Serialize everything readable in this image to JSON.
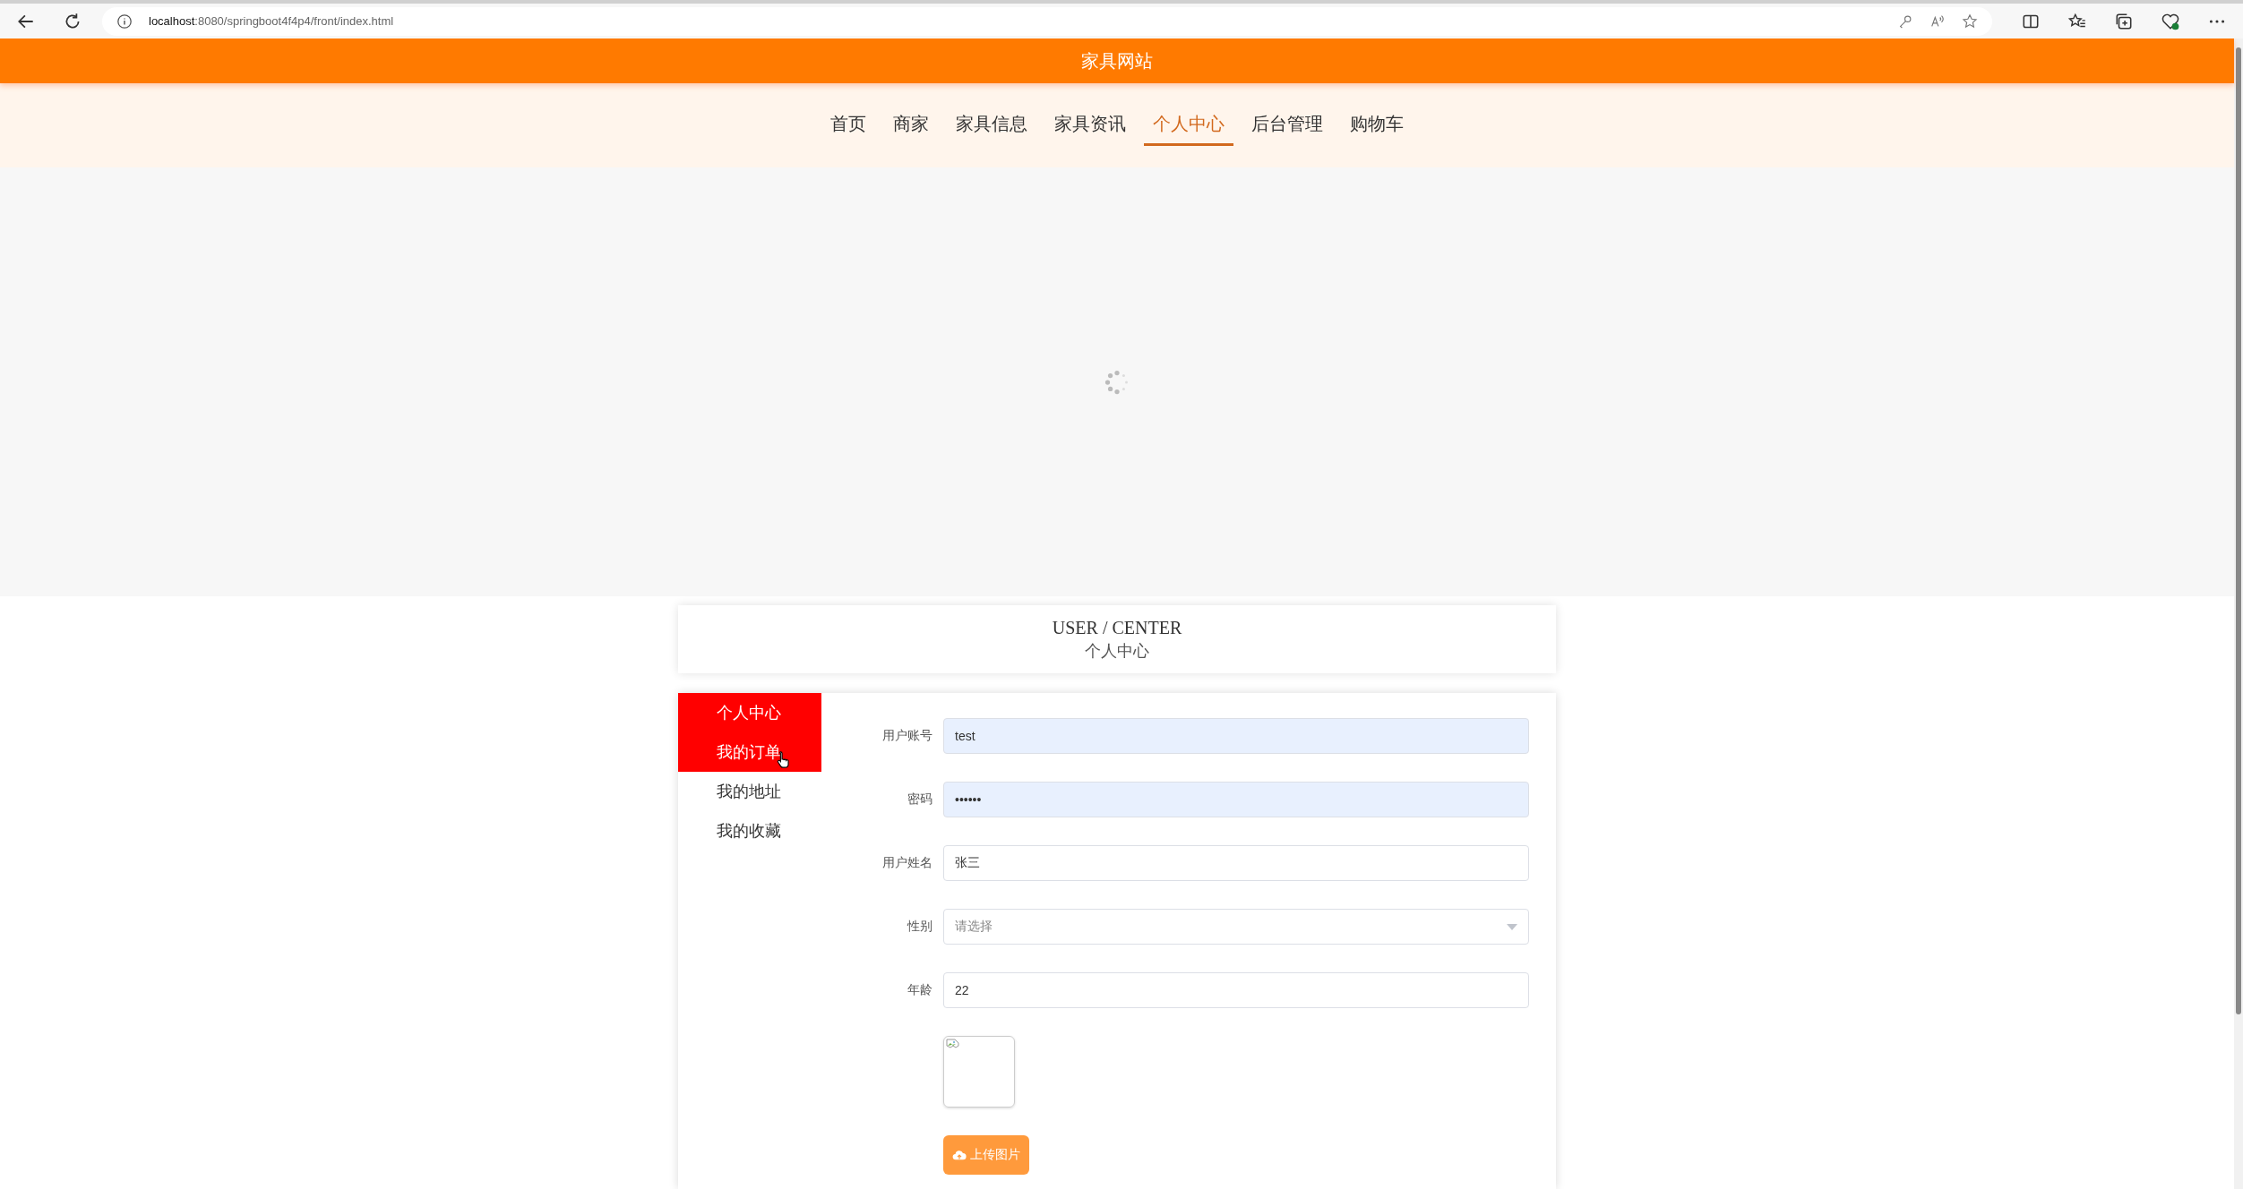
{
  "browser": {
    "url_host": "localhost",
    "url_rest": ":8080/springboot4f4p4/front/index.html"
  },
  "site": {
    "title": "家具网站"
  },
  "nav": [
    {
      "label": "首页",
      "selected": false
    },
    {
      "label": "商家",
      "selected": false
    },
    {
      "label": "家具信息",
      "selected": false
    },
    {
      "label": "家具资讯",
      "selected": false
    },
    {
      "label": "个人中心",
      "selected": true
    },
    {
      "label": "后台管理",
      "selected": false
    },
    {
      "label": "购物车",
      "selected": false
    }
  ],
  "banner": {
    "loading": true
  },
  "section": {
    "title_en": "USER / CENTER",
    "title_cn": "个人中心"
  },
  "sidebar": [
    {
      "label": "个人中心",
      "selected": true,
      "hovered": false
    },
    {
      "label": "我的订单",
      "selected": true,
      "hovered": true
    },
    {
      "label": "我的地址",
      "selected": false,
      "hovered": false
    },
    {
      "label": "我的收藏",
      "selected": false,
      "hovered": false
    }
  ],
  "form": [
    {
      "kind": "text",
      "label": "用户账号",
      "value": "test",
      "autofilled": true
    },
    {
      "kind": "text",
      "label": "密码",
      "value": "••••••",
      "autofilled": true
    },
    {
      "kind": "text",
      "label": "用户姓名",
      "value": "张三",
      "autofilled": false
    },
    {
      "kind": "select",
      "label": "性别",
      "placeholder": "请选择",
      "autofilled": false
    },
    {
      "kind": "text",
      "label": "年龄",
      "value": "22",
      "autofilled": false
    },
    {
      "kind": "image"
    },
    {
      "kind": "upload",
      "label": "上传图片"
    }
  ]
}
